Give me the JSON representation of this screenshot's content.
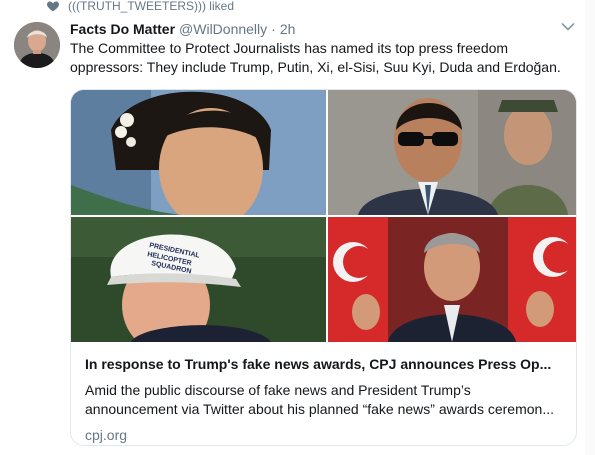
{
  "liked": {
    "text": "(((TRUTH_TWEETERS))) liked",
    "icon": "heart-icon"
  },
  "tweet": {
    "display_name": "Facts Do Matter",
    "handle": "@WilDonnelly",
    "separator": "·",
    "time": "2h",
    "text": "The Committee to Protect Journalists has named its top press freedom oppressors: They include Trump, Putin, Xi, el-Sisi, Suu Kyi, Duda and Erdoğan.",
    "caret_icon": "chevron-down-icon"
  },
  "card": {
    "title": "In response to Trump's fake news awards, CPJ announces Press Op...",
    "description": "Amid the public discourse of fake news and President Trump’s announcement via Twitter about his planned “fake news” awards ceremon...",
    "domain": "cpj.org",
    "cap_text": [
      "PRESIDENTIAL",
      "HELICOPTER",
      "SQUADRON"
    ]
  },
  "colors": {
    "text": "#14171a",
    "secondary": "#657786",
    "border": "#e1e8ed"
  }
}
